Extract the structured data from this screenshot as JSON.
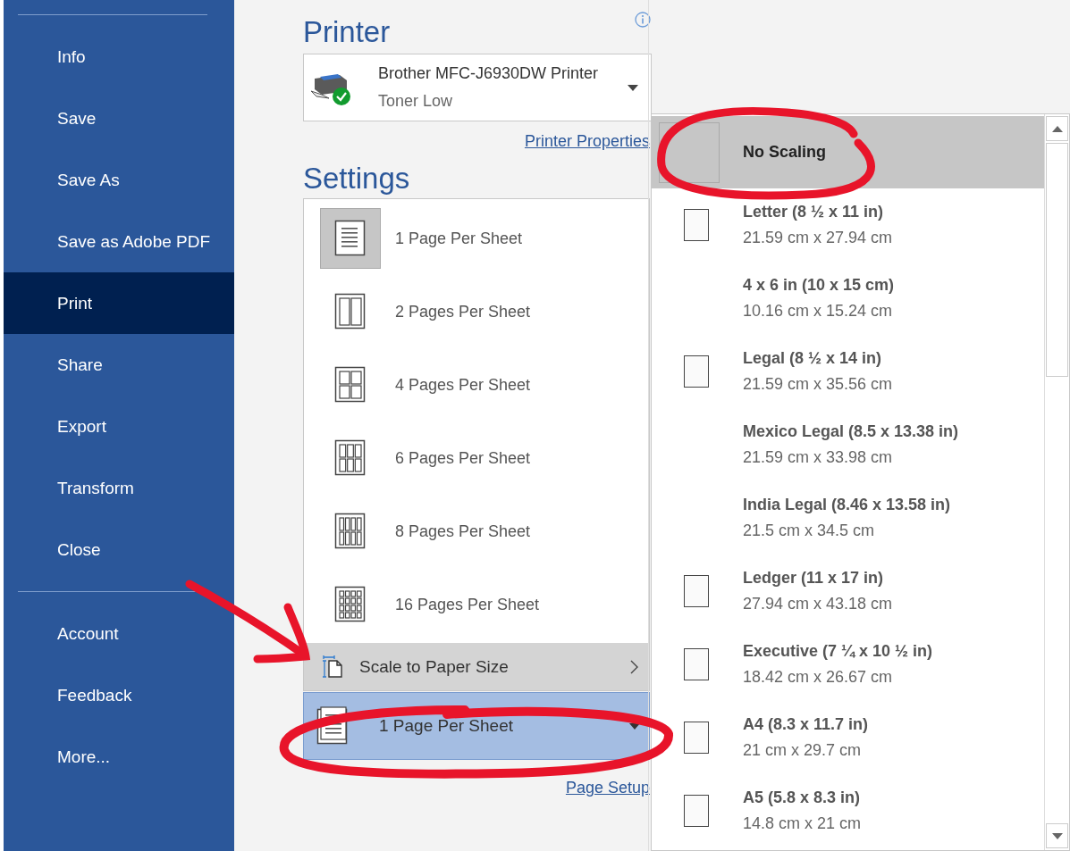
{
  "sidebar": {
    "items": [
      {
        "label": "Info",
        "selected": false
      },
      {
        "label": "Save",
        "selected": false
      },
      {
        "label": "Save As",
        "selected": false
      },
      {
        "label": "Save as Adobe PDF",
        "selected": false
      },
      {
        "label": "Print",
        "selected": true
      },
      {
        "label": "Share",
        "selected": false
      },
      {
        "label": "Export",
        "selected": false
      },
      {
        "label": "Transform",
        "selected": false
      },
      {
        "label": "Close",
        "selected": false
      }
    ],
    "bottom_items": [
      {
        "label": "Account",
        "selected": false
      },
      {
        "label": "Feedback",
        "selected": false
      },
      {
        "label": "More...",
        "selected": false
      }
    ]
  },
  "printer": {
    "heading": "Printer",
    "name": "Brother MFC-J6930DW Printer",
    "status": "Toner Low",
    "properties_link": "Printer Properties"
  },
  "settings": {
    "heading": "Settings",
    "pages_menu": [
      {
        "label": "1 Page Per Sheet",
        "selected": true
      },
      {
        "label": "2 Pages Per Sheet",
        "selected": false
      },
      {
        "label": "4 Pages Per Sheet",
        "selected": false
      },
      {
        "label": "6 Pages Per Sheet",
        "selected": false
      },
      {
        "label": "8 Pages Per Sheet",
        "selected": false
      },
      {
        "label": "16 Pages Per Sheet",
        "selected": false
      }
    ],
    "scale_item": "Scale to Paper Size",
    "pages_combo": "1 Page Per Sheet",
    "page_setup_link": "Page Setup"
  },
  "paper_sizes": [
    {
      "title": "No Scaling",
      "kind": "square",
      "selected": true
    },
    {
      "title": "Letter (8 ½ x 11 in)",
      "subtitle": "21.59 cm x 27.94 cm",
      "kind": "page",
      "selected": false
    },
    {
      "title": "4 x 6 in (10 x 15 cm)",
      "subtitle": "10.16 cm x 15.24 cm",
      "kind": "plain",
      "selected": false
    },
    {
      "title": "Legal (8 ½ x 14 in)",
      "subtitle": "21.59 cm x 35.56 cm",
      "kind": "page",
      "selected": false
    },
    {
      "title": "Mexico Legal (8.5 x 13.38 in)",
      "subtitle": "21.59 cm x 33.98 cm",
      "kind": "plain",
      "selected": false
    },
    {
      "title": "India Legal (8.46 x 13.58 in)",
      "subtitle": "21.5 cm x 34.5 cm",
      "kind": "plain",
      "selected": false
    },
    {
      "title": "Ledger (11 x 17 in)",
      "subtitle": "27.94 cm x 43.18 cm",
      "kind": "page",
      "selected": false
    },
    {
      "title": "Executive (7 ¼ x 10 ½ in)",
      "subtitle": "18.42 cm x 26.67 cm",
      "kind": "page",
      "selected": false
    },
    {
      "title": "A4 (8.3 x 11.7 in)",
      "subtitle": "21 cm x 29.7 cm",
      "kind": "page",
      "selected": false
    },
    {
      "title": "A5 (5.8 x 8.3 in)",
      "subtitle": "14.8 cm x 21 cm",
      "kind": "page",
      "selected": false
    }
  ]
}
